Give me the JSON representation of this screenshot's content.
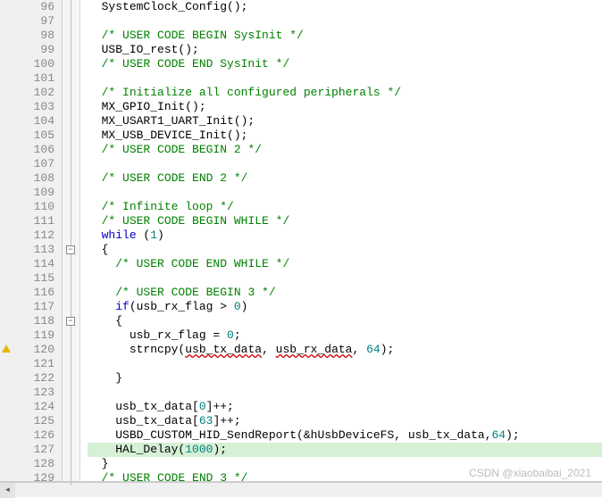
{
  "watermark": "CSDN @xiaobaibai_2021",
  "lines": [
    {
      "num": 96,
      "indent": 2,
      "fold": "|",
      "tokens": [
        [
          "",
          "SystemClock_Config();"
        ]
      ]
    },
    {
      "num": 97,
      "indent": 0,
      "fold": "|",
      "tokens": []
    },
    {
      "num": 98,
      "indent": 2,
      "fold": "|",
      "tokens": [
        [
          "cm",
          "/* USER CODE BEGIN SysInit */"
        ]
      ]
    },
    {
      "num": 99,
      "indent": 2,
      "fold": "|",
      "tokens": [
        [
          "",
          "USB_IO_rest();"
        ]
      ]
    },
    {
      "num": 100,
      "indent": 2,
      "fold": "|",
      "tokens": [
        [
          "cm",
          "/* USER CODE END SysInit */"
        ]
      ]
    },
    {
      "num": 101,
      "indent": 0,
      "fold": "|",
      "tokens": []
    },
    {
      "num": 102,
      "indent": 2,
      "fold": "|",
      "tokens": [
        [
          "cm",
          "/* Initialize all configured peripherals */"
        ]
      ]
    },
    {
      "num": 103,
      "indent": 2,
      "fold": "|",
      "tokens": [
        [
          "",
          "MX_GPIO_Init();"
        ]
      ]
    },
    {
      "num": 104,
      "indent": 2,
      "fold": "|",
      "tokens": [
        [
          "",
          "MX_USART1_UART_Init();"
        ]
      ]
    },
    {
      "num": 105,
      "indent": 2,
      "fold": "|",
      "tokens": [
        [
          "",
          "MX_USB_DEVICE_Init();"
        ]
      ]
    },
    {
      "num": 106,
      "indent": 2,
      "fold": "|",
      "tokens": [
        [
          "cm",
          "/* USER CODE BEGIN 2 */"
        ]
      ]
    },
    {
      "num": 107,
      "indent": 0,
      "fold": "|",
      "tokens": []
    },
    {
      "num": 108,
      "indent": 2,
      "fold": "|",
      "tokens": [
        [
          "cm",
          "/* USER CODE END 2 */"
        ]
      ]
    },
    {
      "num": 109,
      "indent": 0,
      "fold": "|",
      "tokens": []
    },
    {
      "num": 110,
      "indent": 2,
      "fold": "|",
      "tokens": [
        [
          "cm",
          "/* Infinite loop */"
        ]
      ]
    },
    {
      "num": 111,
      "indent": 2,
      "fold": "|",
      "tokens": [
        [
          "cm",
          "/* USER CODE BEGIN WHILE */"
        ]
      ]
    },
    {
      "num": 112,
      "indent": 2,
      "fold": "|",
      "tokens": [
        [
          "kw",
          "while"
        ],
        [
          "",
          " ("
        ],
        [
          "num",
          "1"
        ],
        [
          "",
          ")"
        ]
      ]
    },
    {
      "num": 113,
      "indent": 2,
      "fold": "box",
      "tokens": [
        [
          "",
          "{"
        ]
      ]
    },
    {
      "num": 114,
      "indent": 4,
      "fold": "|",
      "tokens": [
        [
          "cm",
          "/* USER CODE END WHILE */"
        ]
      ]
    },
    {
      "num": 115,
      "indent": 0,
      "fold": "|",
      "tokens": []
    },
    {
      "num": 116,
      "indent": 4,
      "fold": "|",
      "tokens": [
        [
          "cm",
          "/* USER CODE BEGIN 3 */"
        ]
      ]
    },
    {
      "num": 117,
      "indent": 4,
      "fold": "|",
      "tokens": [
        [
          "kw",
          "if"
        ],
        [
          "",
          "(usb_rx_flag > "
        ],
        [
          "num",
          "0"
        ],
        [
          "",
          ")"
        ]
      ]
    },
    {
      "num": 118,
      "indent": 4,
      "fold": "box",
      "tokens": [
        [
          "",
          "{"
        ]
      ]
    },
    {
      "num": 119,
      "indent": 6,
      "fold": "|",
      "tokens": [
        [
          "",
          "usb_rx_flag = "
        ],
        [
          "num",
          "0"
        ],
        [
          "",
          ";"
        ]
      ]
    },
    {
      "num": 120,
      "indent": 6,
      "fold": "|",
      "warn": true,
      "tokens": [
        [
          "",
          "strncpy("
        ],
        [
          "err",
          "usb_tx_data"
        ],
        [
          "",
          ", "
        ],
        [
          "err",
          "usb_rx_data"
        ],
        [
          "",
          ", "
        ],
        [
          "num",
          "64"
        ],
        [
          "",
          ");"
        ]
      ]
    },
    {
      "num": 121,
      "indent": 0,
      "fold": "|",
      "tokens": []
    },
    {
      "num": 122,
      "indent": 4,
      "fold": "|",
      "tokens": [
        [
          "",
          "}"
        ]
      ]
    },
    {
      "num": 123,
      "indent": 0,
      "fold": "|",
      "tokens": []
    },
    {
      "num": 124,
      "indent": 4,
      "fold": "|",
      "tokens": [
        [
          "",
          "usb_tx_data["
        ],
        [
          "num",
          "0"
        ],
        [
          "",
          "]++;"
        ]
      ]
    },
    {
      "num": 125,
      "indent": 4,
      "fold": "|",
      "tokens": [
        [
          "",
          "usb_tx_data["
        ],
        [
          "num",
          "63"
        ],
        [
          "",
          "]++;"
        ]
      ]
    },
    {
      "num": 126,
      "indent": 4,
      "fold": "|",
      "tokens": [
        [
          "",
          "USBD_CUSTOM_HID_SendReport(&hUsbDeviceFS, usb_tx_data,"
        ],
        [
          "num",
          "64"
        ],
        [
          "",
          ");"
        ]
      ]
    },
    {
      "num": 127,
      "indent": 4,
      "fold": "|",
      "hl": true,
      "tokens": [
        [
          "",
          "HAL_Delay("
        ],
        [
          "num",
          "1000"
        ],
        [
          "",
          ");"
        ]
      ]
    },
    {
      "num": 128,
      "indent": 2,
      "fold": "|",
      "tokens": [
        [
          "",
          "}"
        ]
      ]
    },
    {
      "num": 129,
      "indent": 2,
      "fold": "|",
      "tokens": [
        [
          "cm",
          "/* USER CODE END 3 */"
        ]
      ]
    }
  ],
  "scroll": {
    "left": "◄"
  }
}
